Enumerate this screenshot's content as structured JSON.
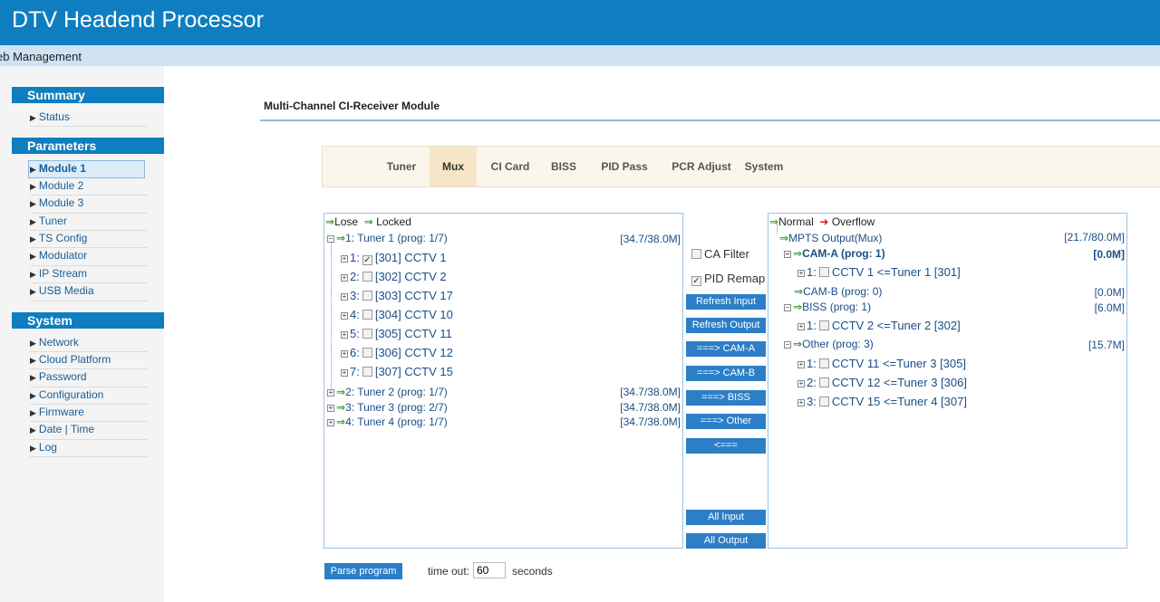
{
  "app": {
    "title": "DTV Headend Processor",
    "subtitle": "eb Management"
  },
  "sidebar": {
    "sections": [
      {
        "heading": "Summary",
        "items": [
          {
            "label": "Status"
          }
        ]
      },
      {
        "heading": "Parameters",
        "items": [
          {
            "label": "Module 1",
            "active": true
          },
          {
            "label": "Module 2"
          },
          {
            "label": "Module 3"
          },
          {
            "label": "Tuner"
          },
          {
            "label": "TS Config"
          },
          {
            "label": "Modulator"
          },
          {
            "label": "IP Stream"
          },
          {
            "label": "USB Media"
          }
        ]
      },
      {
        "heading": "System",
        "items": [
          {
            "label": "Network"
          },
          {
            "label": "Cloud Platform"
          },
          {
            "label": "Password"
          },
          {
            "label": "Configuration"
          },
          {
            "label": "Firmware"
          },
          {
            "label": "Date | Time"
          },
          {
            "label": "Log"
          }
        ]
      }
    ]
  },
  "main": {
    "title": "Multi-Channel CI-Receiver Module",
    "tabs": [
      "Tuner",
      "Mux",
      "CI Card",
      "BISS",
      "PID Pass",
      "PCR Adjust",
      "System"
    ],
    "active_tab": "Mux"
  },
  "input_panel": {
    "legend_lose": "Lose",
    "legend_locked": "Locked",
    "tuner1": {
      "label": "1: Tuner 1 (prog: 1/7)",
      "rate": "[34.7/38.0M]"
    },
    "programs": [
      {
        "idx": "1:",
        "name": "[301] CCTV 1",
        "checked": true
      },
      {
        "idx": "2:",
        "name": "[302] CCTV 2",
        "checked": false
      },
      {
        "idx": "3:",
        "name": "[303] CCTV 17",
        "checked": false
      },
      {
        "idx": "4:",
        "name": "[304] CCTV 10",
        "checked": false
      },
      {
        "idx": "5:",
        "name": "[305] CCTV 11",
        "checked": false
      },
      {
        "idx": "6:",
        "name": "[306] CCTV 12",
        "checked": false
      },
      {
        "idx": "7:",
        "name": "[307] CCTV 15",
        "checked": false,
        "warning": true
      }
    ],
    "tuners": [
      {
        "label": "2: Tuner 2 (prog: 1/7)",
        "rate": "[34.7/38.0M]"
      },
      {
        "label": "3: Tuner 3 (prog: 2/7)",
        "rate": "[34.7/38.0M]"
      },
      {
        "label": "4: Tuner 4 (prog: 1/7)",
        "rate": "[34.7/38.0M]"
      }
    ]
  },
  "controls": {
    "ca_filter": "CA Filter",
    "ca_filter_checked": false,
    "pid_remap": "PID Remap",
    "pid_remap_checked": true,
    "buttons": [
      "Refresh Input",
      "Refresh Output",
      "===> CAM-A",
      "===> CAM-B",
      "===> BISS",
      "===> Other",
      "<==="
    ],
    "all_input": "All Input",
    "all_output": "All Output"
  },
  "output_panel": {
    "legend_normal": "Normal",
    "legend_overflow": "Overflow",
    "mpts": {
      "label": "MPTS Output(Mux)",
      "rate": "[21.7/80.0M]"
    },
    "cam_a": {
      "label": "CAM-A (prog: 1)",
      "rate": "[0.0M]"
    },
    "cam_a_prog": "CCTV 1 <=Tuner 1 [301]",
    "cam_b": {
      "label": "CAM-B (prog: 0)",
      "rate": "[0.0M]"
    },
    "biss": {
      "label": "BISS (prog: 1)",
      "rate": "[6.0M]"
    },
    "biss_prog": "CCTV 2 <=Tuner 2 [302]",
    "other": {
      "label": "Other (prog: 3)",
      "rate": "[15.7M]"
    },
    "other_progs": [
      {
        "idx": "1:",
        "name": "CCTV 11 <=Tuner 3 [305]"
      },
      {
        "idx": "2:",
        "name": "CCTV 12 <=Tuner 3 [306]"
      },
      {
        "idx": "3:",
        "name": "CCTV 15 <=Tuner 4 [307]"
      }
    ]
  },
  "footer": {
    "parse_button": "Parse program",
    "timeout_label": "time out:",
    "timeout_value": "60",
    "seconds": "seconds"
  }
}
